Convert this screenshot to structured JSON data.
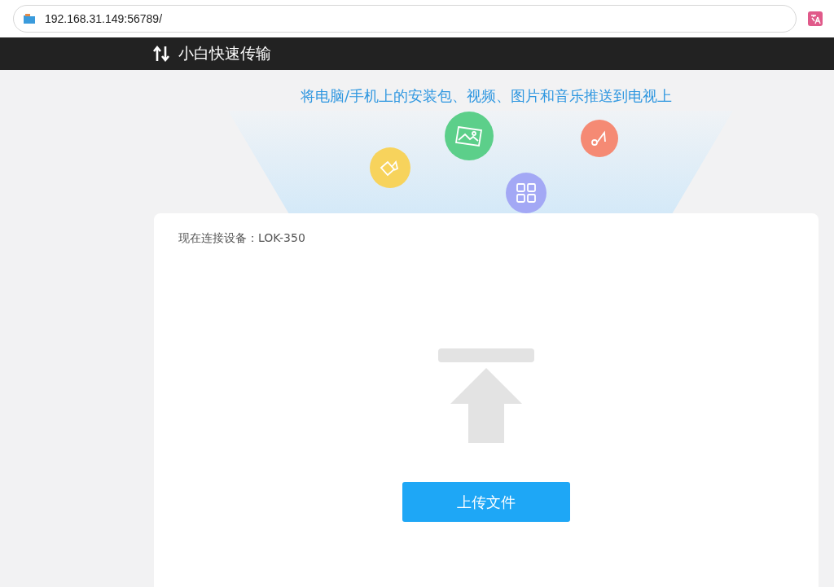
{
  "address_bar": {
    "url": "192.168.31.149:56789/"
  },
  "header": {
    "title": "小白快速传输"
  },
  "hero": {
    "tagline": "将电脑/手机上的安装包、视频、图片和音乐推送到电视上"
  },
  "card": {
    "device_label": "现在连接设备：LOK-350",
    "upload_button": "上传文件"
  }
}
